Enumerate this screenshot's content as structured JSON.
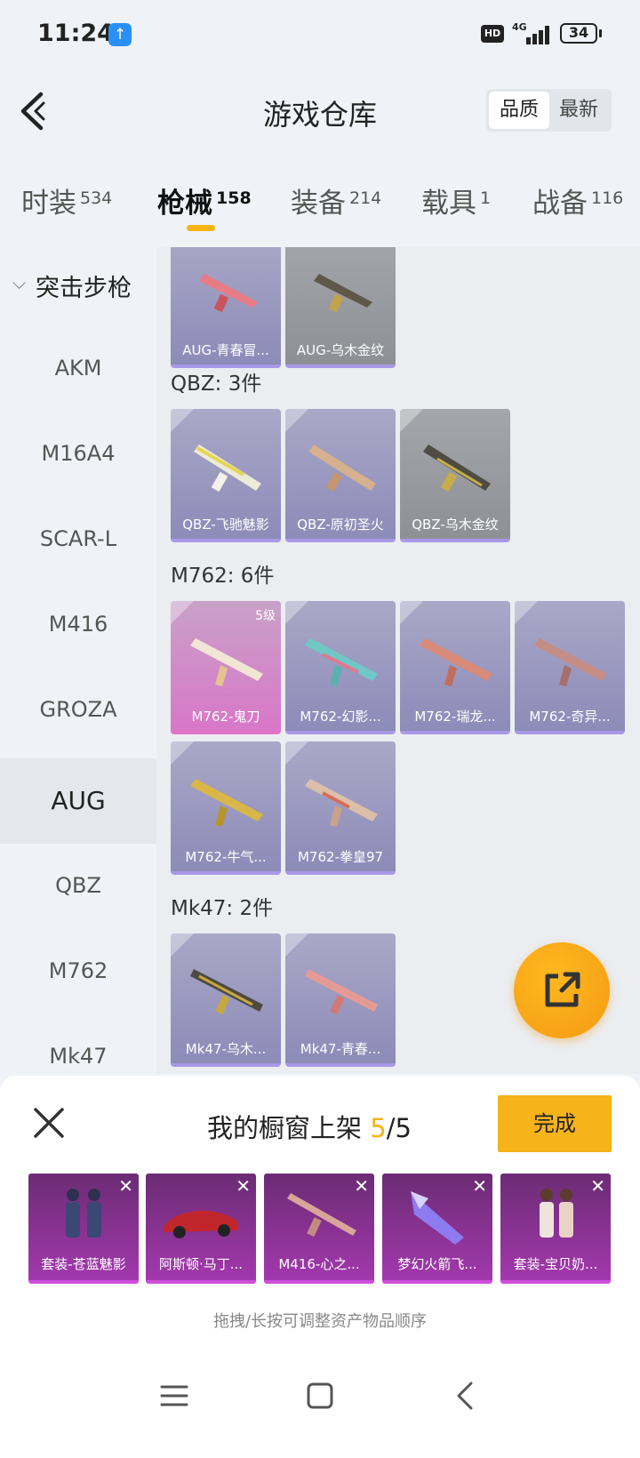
{
  "status_bar": {
    "time": "11:24",
    "hd": "HD",
    "network": "4G",
    "battery": "34"
  },
  "header": {
    "title": "游戏仓库",
    "sort_options": [
      "品质",
      "最新"
    ]
  },
  "category_tabs": [
    {
      "label": "时装",
      "count": "534"
    },
    {
      "label": "枪械",
      "count": "158",
      "active": true
    },
    {
      "label": "装备",
      "count": "214"
    },
    {
      "label": "载具",
      "count": "1"
    },
    {
      "label": "战备",
      "count": "116"
    }
  ],
  "sidebar": {
    "header": "突击步枪",
    "items": [
      "AKM",
      "M16A4",
      "SCAR-L",
      "M416",
      "GROZA",
      "AUG",
      "QBZ",
      "M762",
      "Mk47"
    ],
    "active": "AUG"
  },
  "groups": [
    {
      "title": "",
      "items": [
        {
          "name": "AUG-青春冒..."
        },
        {
          "name": "AUG-乌木金纹"
        }
      ]
    },
    {
      "title": "QBZ: 3件",
      "items": [
        {
          "name": "QBZ-飞驰魅影"
        },
        {
          "name": "QBZ-原初圣火"
        },
        {
          "name": "QBZ-乌木金纹"
        }
      ]
    },
    {
      "title": "M762: 6件",
      "items": [
        {
          "name": "M762-鬼刀",
          "level": "5级"
        },
        {
          "name": "M762-幻影..."
        },
        {
          "name": "M762-瑞龙..."
        },
        {
          "name": "M762-奇异..."
        },
        {
          "name": "M762-牛气..."
        },
        {
          "name": "M762-拳皇97"
        }
      ]
    },
    {
      "title": "Mk47: 2件",
      "items": [
        {
          "name": "Mk47-乌木..."
        },
        {
          "name": "Mk47-青春..."
        }
      ]
    }
  ],
  "shelf": {
    "title": "我的橱窗上架",
    "current": "5",
    "separator": "/",
    "max": "5",
    "done_label": "完成",
    "items": [
      "套装-苍蓝魅影",
      "阿斯顿·马丁...",
      "M416-心之...",
      "梦幻火箭飞...",
      "套装-宝贝奶..."
    ],
    "hint": "拖拽/长按可调整资产物品顺序"
  },
  "colors": {
    "accent": "#f5b316",
    "card_purple": "#a997e8",
    "shelf_magenta": "#a238ad"
  },
  "icons": {
    "back": "chevron-left-icon",
    "share": "share-external-icon",
    "close": "close-icon",
    "menu": "menu-icon",
    "home": "home-square-icon",
    "nav_back": "nav-back-icon"
  }
}
